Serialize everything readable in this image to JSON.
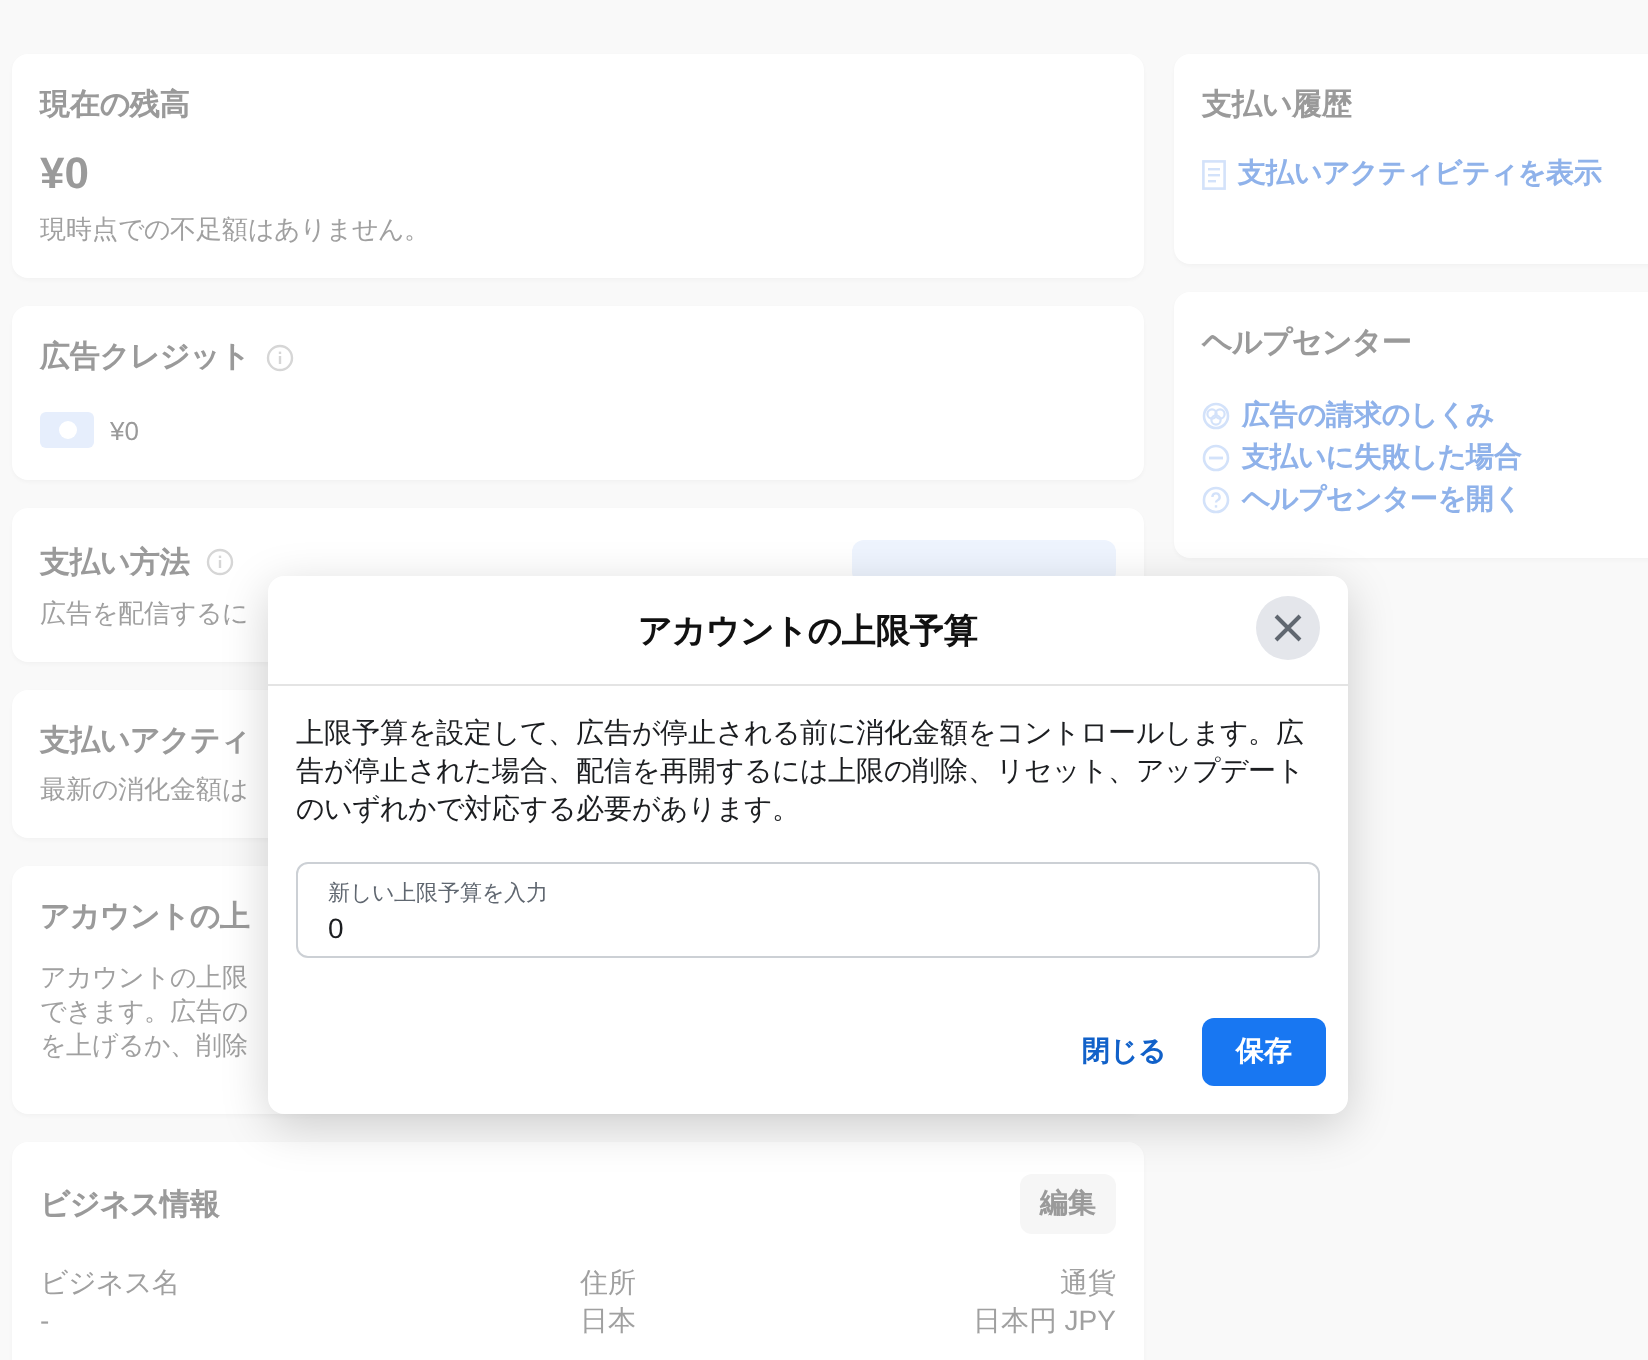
{
  "balance_card": {
    "title": "現在の残高",
    "amount": "¥0",
    "note": "現時点での不足額はありません。"
  },
  "ad_credit_card": {
    "title": "広告クレジット",
    "amount": "¥0"
  },
  "payment_method_card": {
    "title": "支払い方法",
    "note": "広告を配信するに"
  },
  "payment_activity_card": {
    "title": "支払いアクティ",
    "note": "最新の消化金額は"
  },
  "spending_limit_card": {
    "title": "アカウントの上",
    "lines": [
      "アカウントの上限",
      "できます。広告の",
      "を上げるか、削除"
    ]
  },
  "business_info_card": {
    "title": "ビジネス情報",
    "edit_button": "編集",
    "fields": [
      {
        "label": "ビジネス名",
        "value": "-"
      },
      {
        "label": "住所",
        "value": "日本"
      },
      {
        "label": "通貨",
        "value": "日本円 JPY"
      }
    ]
  },
  "payment_history_card": {
    "title": "支払い履歴",
    "link": "支払いアクティビティを表示"
  },
  "help_center_card": {
    "title": "ヘルプセンター",
    "links": [
      {
        "kind": "billing",
        "label": "広告の請求のしくみ"
      },
      {
        "kind": "failed",
        "label": "支払いに失敗した場合"
      },
      {
        "kind": "help",
        "label": "ヘルプセンターを開く"
      }
    ]
  },
  "dialog": {
    "title": "アカウントの上限予算",
    "description": "上限予算を設定して、広告が停止される前に消化金額をコントロールします。広告が停止された場合、配信を再開するには上限の削除、リセット、アップデートのいずれかで対応する必要があります。",
    "field": {
      "label": "新しい上限予算を入力",
      "value": "0"
    },
    "buttons": [
      {
        "kind": "text",
        "label": "閉じる"
      },
      {
        "kind": "primary",
        "label": "保存"
      }
    ]
  }
}
